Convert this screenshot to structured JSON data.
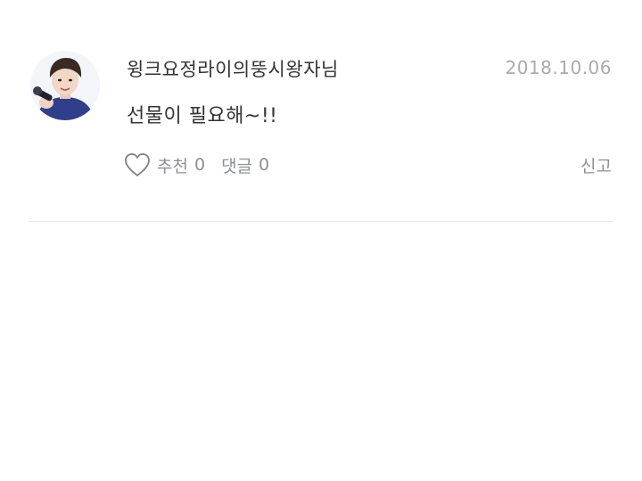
{
  "post": {
    "username": "윙크요정라이의뚱시왕자님",
    "date": "2018.10.06",
    "message": "선물이 필요해~!!",
    "like": {
      "icon": "heart-outline-icon",
      "label": "추천",
      "count": "0"
    },
    "comment": {
      "label": "댓글",
      "count": "0"
    },
    "report_label": "신고",
    "avatar_icon": "user-avatar-photo"
  },
  "colors": {
    "text_primary": "#333333",
    "text_muted": "#8d9096",
    "date_text": "#a8abb1",
    "divider": "#e4e6e9",
    "background": "#ffffff"
  }
}
